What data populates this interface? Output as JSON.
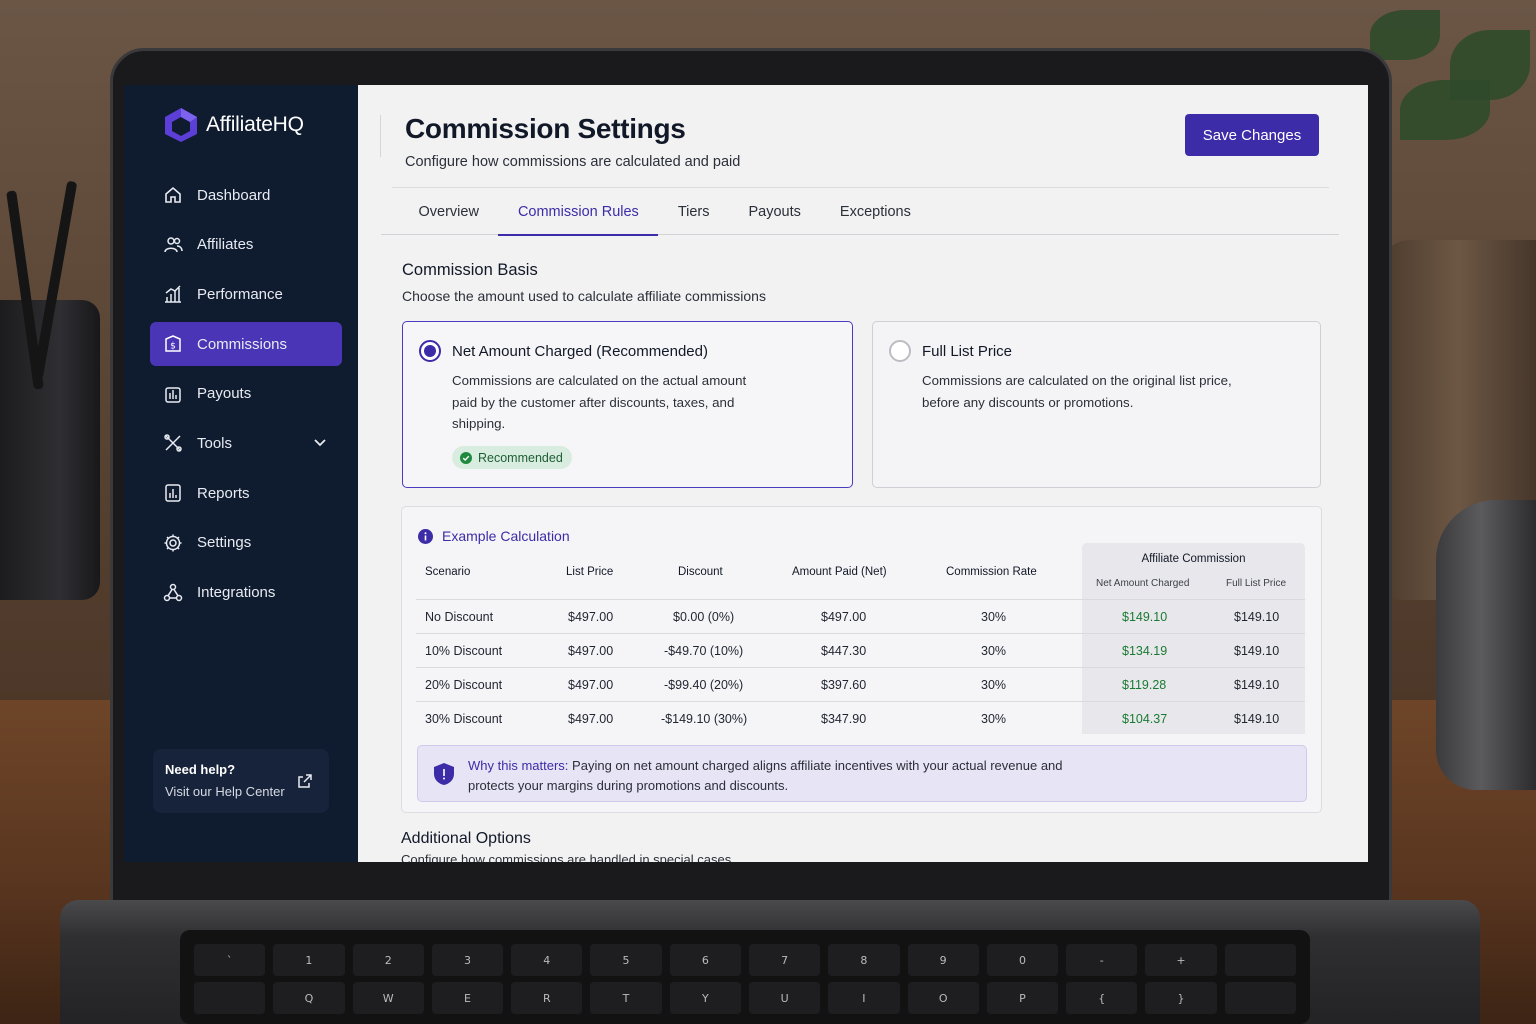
{
  "app": {
    "brand": "AffiliateHQ"
  },
  "sidebar": {
    "items": [
      {
        "label": "Dashboard",
        "icon": "home-icon"
      },
      {
        "label": "Affiliates",
        "icon": "users-icon"
      },
      {
        "label": "Performance",
        "icon": "bar-chart-icon"
      },
      {
        "label": "Commissions",
        "icon": "dollar-tag-icon",
        "active": true
      },
      {
        "label": "Payouts",
        "icon": "payouts-icon"
      },
      {
        "label": "Tools",
        "icon": "tools-icon",
        "expandable": true
      },
      {
        "label": "Reports",
        "icon": "reports-icon"
      },
      {
        "label": "Settings",
        "icon": "gear-icon"
      },
      {
        "label": "Integrations",
        "icon": "integrations-icon"
      }
    ],
    "help": {
      "title": "Need help?",
      "link": "Visit our Help Center"
    }
  },
  "header": {
    "title": "Commission Settings",
    "subtitle": "Configure how commissions are calculated and paid",
    "save_label": "Save Changes"
  },
  "tabs": [
    {
      "label": "Overview"
    },
    {
      "label": "Commission Rules",
      "active": true
    },
    {
      "label": "Tiers"
    },
    {
      "label": "Payouts"
    },
    {
      "label": "Exceptions"
    }
  ],
  "commission_basis": {
    "title": "Commission Basis",
    "subtitle": "Choose the amount used to calculate affiliate commissions",
    "options": [
      {
        "title": "Net Amount Charged (Recommended)",
        "description": "Commissions are calculated on the actual amount paid by the customer after discounts, taxes, and shipping.",
        "badge": "Recommended",
        "selected": true
      },
      {
        "title": "Full List Price",
        "description": "Commissions are calculated on the original list price, before any discounts or promotions.",
        "selected": false
      }
    ]
  },
  "example": {
    "title": "Example Calculation",
    "columns": [
      "Scenario",
      "List Price",
      "Discount",
      "Amount Paid (Net)",
      "Commission Rate"
    ],
    "commission_group": "Affiliate Commission",
    "commission_cols": [
      "Net Amount Charged",
      "Full List Price"
    ],
    "rows": [
      {
        "scenario": "No Discount",
        "list": "$497.00",
        "discount": "$0.00 (0%)",
        "paid": "$497.00",
        "rate": "30%",
        "net": "$149.10",
        "full": "$149.10"
      },
      {
        "scenario": "10% Discount",
        "list": "$497.00",
        "discount": "-$49.70 (10%)",
        "paid": "$447.30",
        "rate": "30%",
        "net": "$134.19",
        "full": "$149.10"
      },
      {
        "scenario": "20% Discount",
        "list": "$497.00",
        "discount": "-$99.40 (20%)",
        "paid": "$397.60",
        "rate": "30%",
        "net": "$119.28",
        "full": "$149.10"
      },
      {
        "scenario": "30% Discount",
        "list": "$497.00",
        "discount": "-$149.10 (30%)",
        "paid": "$347.90",
        "rate": "30%",
        "net": "$104.37",
        "full": "$149.10"
      }
    ],
    "why_label": "Why this matters:",
    "why_text": "Paying on net amount charged aligns affiliate incentives with your actual revenue and protects your margins during promotions and discounts."
  },
  "additional": {
    "title": "Additional Options",
    "subtitle": "Configure how commissions are handled in special cases."
  },
  "colors": {
    "accent": "#3d2ca8",
    "sidebar": "#0f1b2e",
    "positive": "#1a7a32"
  }
}
